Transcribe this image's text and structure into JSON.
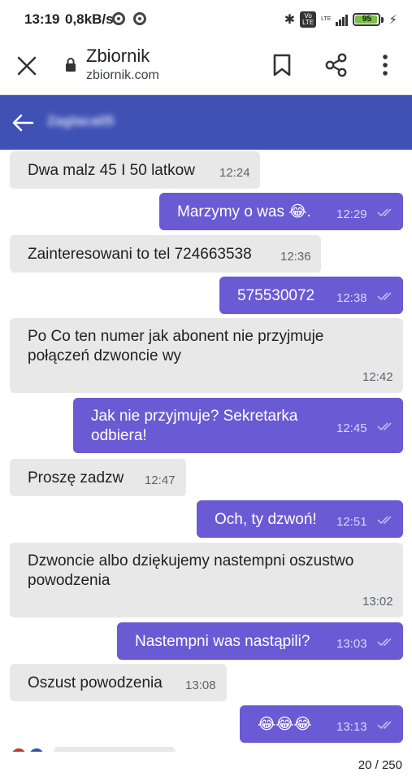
{
  "status_bar": {
    "time": "13:19",
    "speed": "0,8kB/s",
    "volte_label": "Vo LTE",
    "lte_label": "LTE",
    "battery": "95"
  },
  "browser": {
    "title": "Zbiornik",
    "url": "zbiornik.com"
  },
  "chat": {
    "contact_name": "Zaglaca05"
  },
  "messages": [
    {
      "direction": "in",
      "text": "Dwa malz 45 I 50 latkow",
      "time": "12:24"
    },
    {
      "direction": "out",
      "text": "Marzymy o was 😂.",
      "time": "12:29"
    },
    {
      "direction": "in",
      "text": "Zainteresowani to tel 724663538",
      "time": "12:36"
    },
    {
      "direction": "out",
      "text": "575530072",
      "time": "12:38"
    },
    {
      "direction": "in",
      "text": "Po Co ten numer jak abonent nie przyjmuje połączeń dzwoncie wy",
      "time": "12:42"
    },
    {
      "direction": "out",
      "text": "Jak nie przyjmuje? Sekretarka odbiera!",
      "time": "12:45"
    },
    {
      "direction": "in",
      "text": "Proszę zadzw",
      "time": "12:47"
    },
    {
      "direction": "out",
      "text": "Och, ty dzwoń!",
      "time": "12:51"
    },
    {
      "direction": "in",
      "text": "Dzwoncie albo dziękujemy nastempni oszustwo powodzenia",
      "time": "13:02"
    },
    {
      "direction": "out",
      "text": "Nastempni was nastąpili?",
      "time": "13:03"
    },
    {
      "direction": "in",
      "text": "Oszust powodzenia",
      "time": "13:08"
    },
    {
      "direction": "out",
      "text": "😂😂😂",
      "time": "13:13"
    }
  ],
  "footer": {
    "page_count": "20 / 250"
  },
  "colors": {
    "header": "#3f51b5",
    "outgoing_bubble": "#6a5ad4",
    "incoming_bubble": "#e8e8e8",
    "battery": "#7ac142"
  },
  "icons": [
    "close-icon",
    "lock-icon",
    "bookmark-icon",
    "share-icon",
    "more-icon",
    "back-arrow-icon",
    "double-check-icon",
    "bluetooth-icon",
    "chrome-icon"
  ]
}
